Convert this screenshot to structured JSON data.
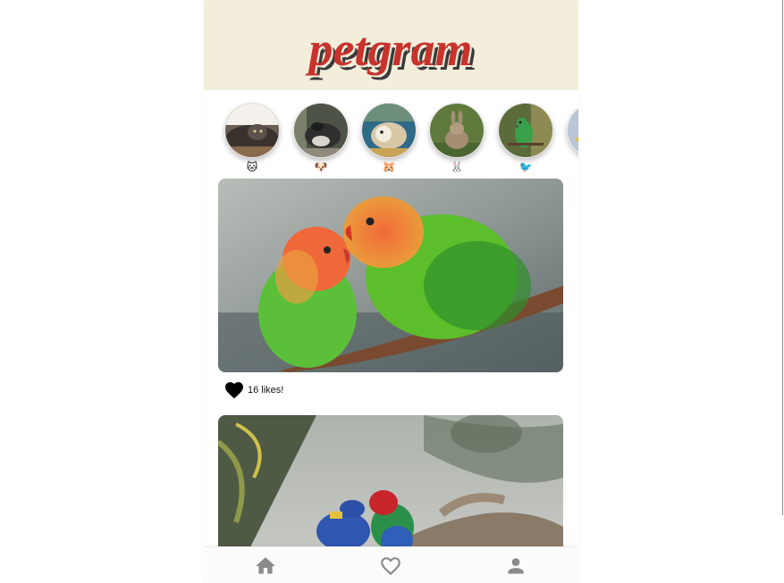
{
  "app": {
    "logo_text": "petgram"
  },
  "colors": {
    "header_bg": "#f2eedb",
    "logo_fill": "#c8332c",
    "logo_shadow": "#3a3a3a",
    "icon_color": "#8a8a8a",
    "heart_color": "#000000"
  },
  "stories": [
    {
      "name": "cats",
      "emoji": "🐱",
      "icon": "cat-face-icon"
    },
    {
      "name": "dogs",
      "emoji": "🐶",
      "icon": "dog-face-icon"
    },
    {
      "name": "hamsters",
      "emoji": "🐹",
      "icon": "hamster-face-icon"
    },
    {
      "name": "rabbits",
      "emoji": "🐰",
      "icon": "rabbit-face-icon"
    },
    {
      "name": "birds",
      "emoji": "🐦",
      "icon": "bird-icon"
    }
  ],
  "posts": [
    {
      "likes_text": "16 likes!",
      "subject": "lovebirds"
    },
    {
      "subject": "macaws"
    }
  ],
  "nav": [
    {
      "icon": "home-icon"
    },
    {
      "icon": "heart-outline-icon"
    },
    {
      "icon": "user-icon"
    }
  ]
}
